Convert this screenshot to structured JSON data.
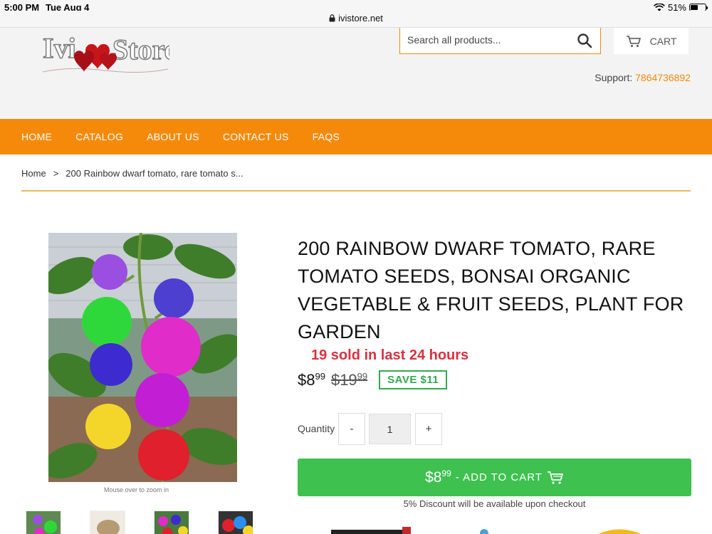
{
  "status_bar": {
    "time": "5:00 PM",
    "date": "Tue Aug 4",
    "battery": "51%",
    "battery_level": 0.51
  },
  "browser": {
    "url": "ivistore.net"
  },
  "header": {
    "logo_text": "Ivi Store",
    "search_placeholder": "Search all products...",
    "cart_label": "CART",
    "support_label": "Support:",
    "support_phone": "7864736892"
  },
  "nav": {
    "items": [
      "HOME",
      "CATALOG",
      "ABOUT US",
      "CONTACT US",
      "FAQS"
    ]
  },
  "breadcrumb": {
    "home": "Home",
    "separator": ">",
    "current": "200 Rainbow dwarf tomato, rare tomato s..."
  },
  "product": {
    "title": "200 RAINBOW DWARF TOMATO, RARE TOMATO SEEDS, BONSAI ORGANIC VEGETABLE & FRUIT SEEDS, PLANT FOR GARDEN",
    "sold_text": "19 sold in last 24 hours",
    "price_main": "$8",
    "price_cents": "99",
    "compare_main": "$19",
    "compare_cents": "99",
    "save_badge": "SAVE $11",
    "quantity_label": "Quantity",
    "quantity_value": "1",
    "minus": "-",
    "plus": "+",
    "add_to_cart_price_main": "$8",
    "add_to_cart_price_cents": "99",
    "add_to_cart_label": "- ADD TO CART",
    "discount_note": "5% Discount will be available upon checkout",
    "zoom_note": "Mouse over to zoom in"
  },
  "colors": {
    "accent": "#f58a0a",
    "sold": "#d9303e",
    "save": "#33a852",
    "add_to_cart": "#3ec14f"
  }
}
